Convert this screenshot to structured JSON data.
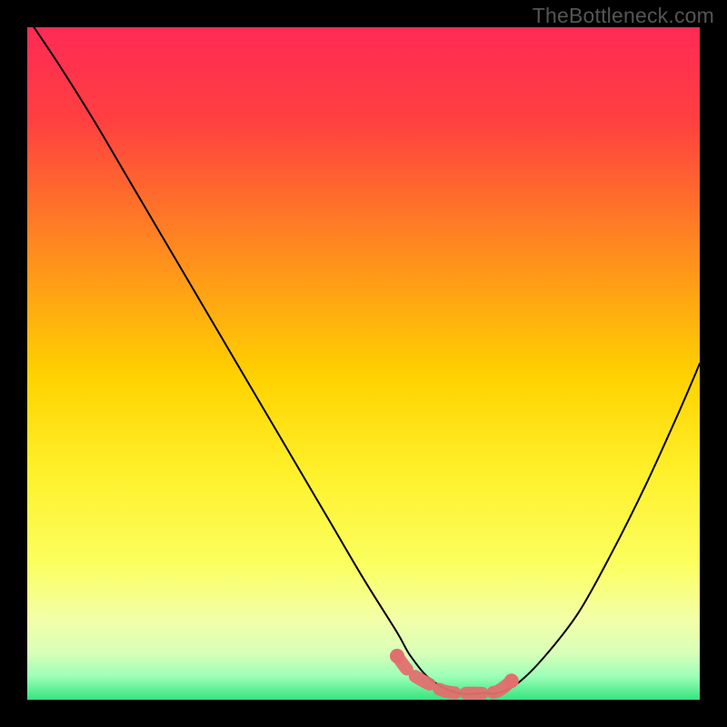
{
  "watermark": "TheBottleneck.com",
  "colors": {
    "frame": "#000000",
    "gradient_stops": [
      {
        "offset": 0.0,
        "color": "#ff2a55"
      },
      {
        "offset": 0.14,
        "color": "#ff4040"
      },
      {
        "offset": 0.33,
        "color": "#ff8a1f"
      },
      {
        "offset": 0.52,
        "color": "#ffd200"
      },
      {
        "offset": 0.66,
        "color": "#fff02a"
      },
      {
        "offset": 0.8,
        "color": "#fbff60"
      },
      {
        "offset": 0.88,
        "color": "#f3ffa8"
      },
      {
        "offset": 0.93,
        "color": "#d9ffb8"
      },
      {
        "offset": 0.965,
        "color": "#9dffb8"
      },
      {
        "offset": 1.0,
        "color": "#35e57d"
      }
    ],
    "curve": "#000000",
    "trough_marker": "#e26f6d"
  },
  "chart_data": {
    "type": "line",
    "title": "",
    "xlabel": "",
    "ylabel": "",
    "xlim": [
      0,
      100
    ],
    "ylim": [
      0,
      100
    ],
    "series": [
      {
        "name": "bottleneck-curve",
        "x": [
          1,
          5,
          10,
          15,
          20,
          25,
          30,
          35,
          40,
          45,
          50,
          55,
          57,
          60,
          64,
          68,
          70,
          73,
          77,
          82,
          87,
          92,
          97,
          100
        ],
        "y": [
          100,
          94,
          86,
          77.5,
          69,
          60.5,
          52,
          43.5,
          35,
          26.5,
          18,
          10,
          6.5,
          3,
          1,
          1,
          1,
          2.5,
          6.5,
          13,
          22,
          32,
          43,
          50
        ]
      }
    ],
    "trough_markers": {
      "x": [
        55,
        57,
        60,
        62,
        64,
        66,
        68,
        70,
        72
      ],
      "y": [
        6.5,
        4,
        2.2,
        1.3,
        1,
        1,
        1,
        1.3,
        2.8
      ]
    }
  }
}
